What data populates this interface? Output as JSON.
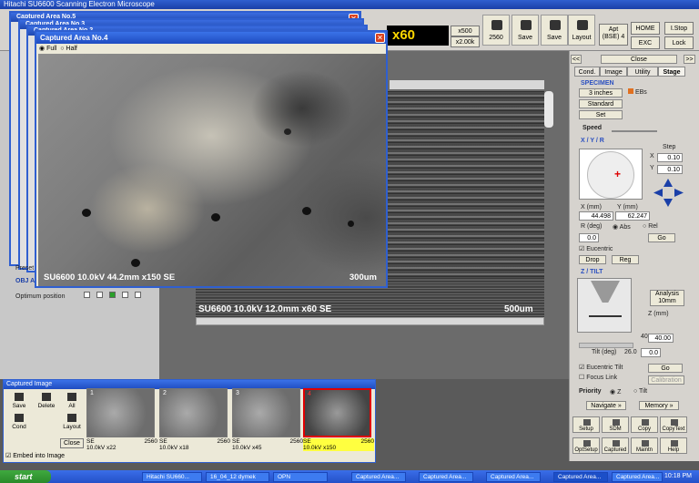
{
  "app": {
    "title": "Hitachi SU6600 Scanning Electron Microscope"
  },
  "toolbar": {
    "magnification": "x60",
    "mag_buttons": [
      "x500",
      "x2.00k"
    ],
    "save": "Save",
    "save2": "Save",
    "layout": "Layout",
    "count": "2560",
    "apt": "Apt (BSE) 4",
    "home": "HOME",
    "exc": "EXC",
    "stop": "I.Stop",
    "lock": "Lock"
  },
  "stack_windows": [
    "Captured Area No.5",
    "Captured Area No.3",
    "Captured Area No.2"
  ],
  "captured_window": {
    "title": "Captured Area No.4",
    "radio_full": "Full",
    "radio_half": "Half",
    "caption": "SU6600 10.0kV 44.2mm x150 SE",
    "scale": "300um"
  },
  "live_view": {
    "caption": "SU6600 10.0kV 12.0mm x60 SE",
    "scale": "500um"
  },
  "left_panel": {
    "preset": "Preset",
    "obj": "OBJ A",
    "optimum": "Optimum position",
    "off": "Off",
    "apertures": [
      "1",
      "2",
      "3",
      "4"
    ]
  },
  "right_panel": {
    "close": "Close",
    "tabs": [
      "Cond.",
      "Image",
      "Utility",
      "Stage"
    ],
    "specimen": "SPECIMEN",
    "spec_size": "3 inches",
    "spec_ebs": "EBs",
    "standard": "Standard",
    "set": "Set",
    "speed": "Speed",
    "xyr": "X / Y / R",
    "step": "Step",
    "step_x": "0.10",
    "step_y": "0.10",
    "x_label": "X (mm)",
    "y_label": "Y (mm)",
    "x_val": "44.498",
    "y_val": "62.247",
    "r_label": "R (deg)",
    "abs": "Abs",
    "rel": "Rel",
    "r_val": "0.0",
    "go": "Go",
    "eucentric": "Eucentric",
    "drop": "Drop",
    "reg": "Reg",
    "zt": "Z / TILT",
    "analysis": "Analysis 10mm",
    "z_mm": "Z (mm)",
    "z_val": "40.00",
    "z_max": "40.00",
    "tilt_label": "Tilt (deg)",
    "tilt_max": "26.0",
    "tilt_val": "0.0",
    "eucentric_tilt": "Eucentric Tilt",
    "go2": "Go",
    "focus_link": "Focus Link",
    "calibration": "Calibration",
    "priority": "Priority",
    "pz": "Z",
    "ptilt": "Tilt",
    "navigate": "Navigate »",
    "memory": "Memory »",
    "bottom_buttons": [
      "Setup",
      "SDM",
      "Copy",
      "CopyText",
      "OptSetup",
      "Captured",
      "Maintn",
      "Help"
    ]
  },
  "captured_image_panel": {
    "title": "Captured Image",
    "buttons": [
      "Save",
      "Delete",
      "All",
      "Cond",
      "Close",
      "Layout"
    ],
    "thumbs": [
      {
        "num": "1",
        "line1": "SE",
        "line2": "10.0kV x22",
        "size": "2560"
      },
      {
        "num": "2",
        "line1": "SE",
        "line2": "10.0kV x18",
        "size": "2560"
      },
      {
        "num": "3",
        "line1": "SE",
        "line2": "10.0kV x45",
        "size": "2560"
      },
      {
        "num": "4",
        "line1": "SE",
        "line2": "10.0kV x150",
        "size": "2560"
      }
    ],
    "embed": "Embed into Image"
  },
  "taskbar": {
    "start": "start",
    "items": [
      "Hitachi SU660...",
      "16_04_12 dymek",
      "OPN",
      "Captured Area...",
      "Captured Area...",
      "Captured Area...",
      "Captured Area...",
      "Captured Area..."
    ],
    "clock": "10:18 PM"
  }
}
